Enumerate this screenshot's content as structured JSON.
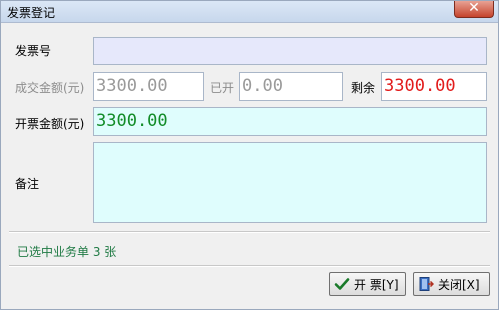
{
  "window": {
    "title": "发票登记",
    "close_icon": "close-icon"
  },
  "form": {
    "invoice_no": {
      "label": "发票号",
      "value": ""
    },
    "deal_amount": {
      "label": "成交金额(元)",
      "value": "3300.00"
    },
    "issued": {
      "label": "已开",
      "value": "0.00"
    },
    "remaining": {
      "label": "剩余",
      "value": "3300.00"
    },
    "invoice_amount": {
      "label": "开票金额(元)",
      "value": "3300.00"
    },
    "remark": {
      "label": "备注",
      "value": ""
    }
  },
  "status": {
    "text": "已选中业务单 3 张"
  },
  "buttons": {
    "issue": {
      "label": "开 票[Y]",
      "icon": "check-icon"
    },
    "close": {
      "label": "关闭[X]",
      "icon": "door-exit-icon"
    }
  },
  "colors": {
    "remaining": "#e21b1b",
    "invoice_amount": "#128c28",
    "status": "#1f7a44"
  }
}
